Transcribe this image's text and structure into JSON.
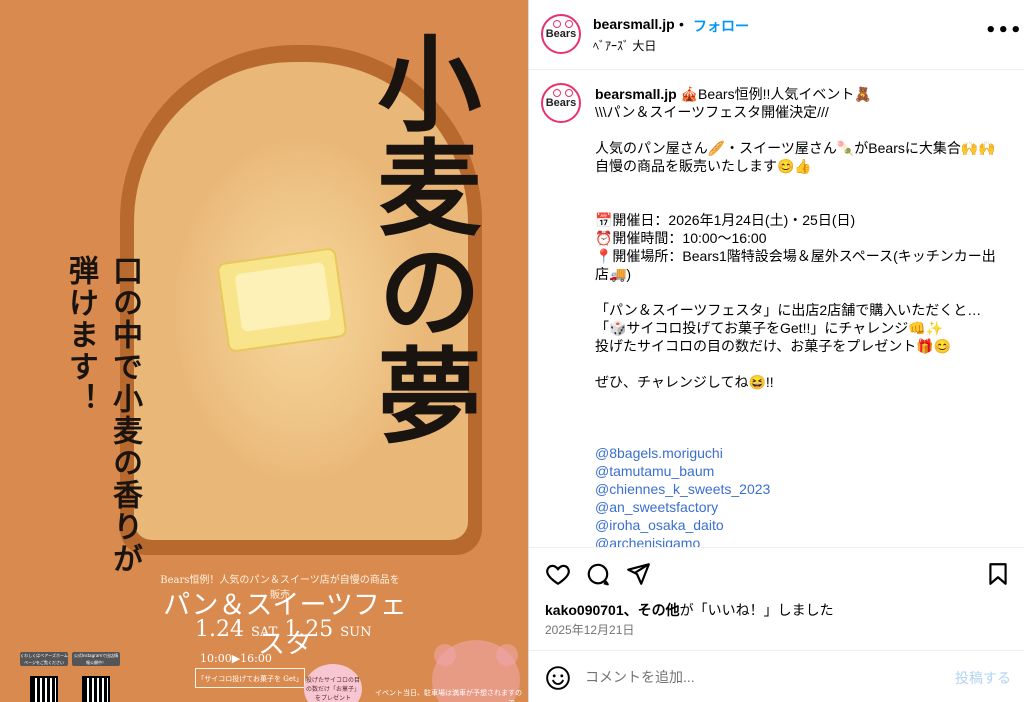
{
  "poster": {
    "title_chars": [
      "小",
      "麦",
      "の",
      "夢"
    ],
    "tagline": "口の中で小麦の香りが弾けます！",
    "subline": "Bears恒例！人気のパン＆スイーツ店が自慢の商品を販売",
    "fest_name": "パン＆スイーツフェスタ",
    "date1": "1.24",
    "dow1": "SAT",
    "date2": "1.25",
    "dow2": "SUN",
    "hours": "10:00▶16:00",
    "promo": "「サイコロ投げてお菓子を Get」",
    "bubble": "投げたサイコロの目の数だけ「お菓子」をプレゼント",
    "notice": "イベント当日、駐車場は満車が予想されますので、",
    "qr1_label": "くわしくはベアーズホームページをご覧ください",
    "qr2_label": "公式Instagramで出店情報公開中！"
  },
  "header": {
    "avatar_text": "Bears",
    "username": "bearsmall.jp",
    "dot": "•",
    "follow_label": "フォロー",
    "location": "ﾍﾞｱｰｽﾞ 大日",
    "more_icon": "more-horizontal-icon"
  },
  "caption": {
    "username": "bearsmall.jp",
    "text": "🎪Bears恒例!!人気イベント🧸\n\\\\\\パン＆スイーツフェスタ開催決定///\n\n人気のパン屋さん🥖・スイーツ屋さん🍡がBearsに大集合🙌🙌\n自慢の商品を販売いたします😊👍\n\n\n📅開催日：2026年1月24日(土)・25日(日)\n⏰開催時間：10:00〜16:00\n📍開催場所：Bears1階特設会場＆屋外スペース(キッチンカー出店🚚)\n\n「パン＆スイーツフェスタ」に出店2店舗で購入いただくと…\n「🎲サイコロ投げてお菓子をGet!!」にチャレンジ👊✨\n投げたサイコロの目の数だけ、お菓子をプレゼント🎁😊\n\nぜひ、チャレンジしてね😆!!",
    "tags": [
      "@8bagels.moriguchi",
      "@tamutamu_baum",
      "@chiennes_k_sweets_2023",
      "@an_sweetsfactory",
      "@iroha_osaka_daito",
      "@archenisigamo"
    ]
  },
  "actions": {
    "like_icon": "heart-icon",
    "comment_icon": "comment-icon",
    "share_icon": "share-icon",
    "save_icon": "bookmark-icon"
  },
  "likes": {
    "user": "kako090701",
    "suffix": "、その他",
    "text": "が「いいね！」しました"
  },
  "post_date": "2025年12月21日",
  "comment": {
    "placeholder": "コメントを追加...",
    "post_label": "投稿する"
  },
  "colors": {
    "poster_bg": "#d98a4e",
    "accent_blue": "#0095f6",
    "avatar_ring": "#e8326b",
    "link": "#3a6fcf"
  }
}
